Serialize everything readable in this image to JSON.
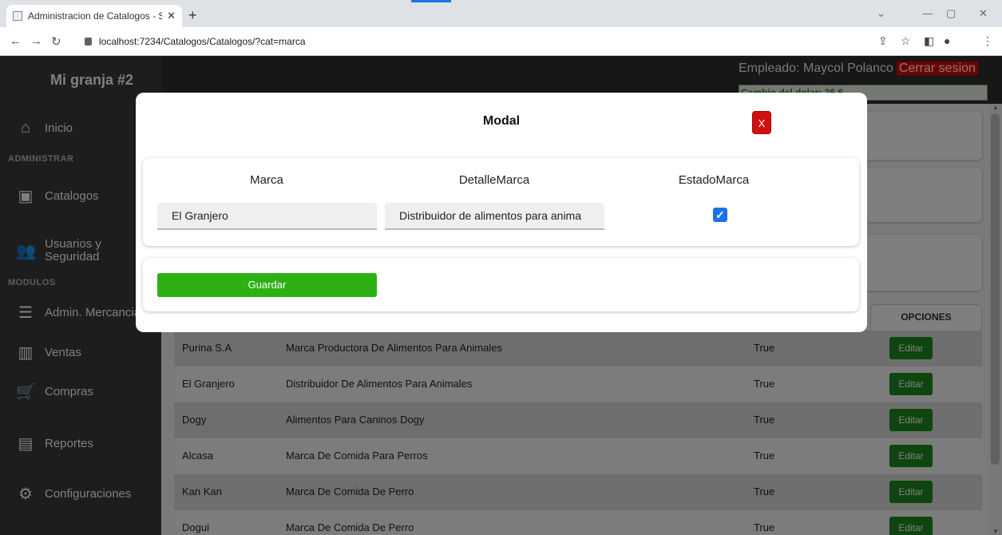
{
  "browser": {
    "tab_title": "Administracion de Catalogos - Si",
    "tab_close": "✕",
    "new_tab": "+",
    "url": "localhost:7234/Catalogos/Catalogos/?cat=marca"
  },
  "app": {
    "brand": "Mi granja #2",
    "empleado_label": "Empleado: Maycol Polanco",
    "logout_label": "Cerrar sesion",
    "dolar_label": "Cambio del dolar: 36.6"
  },
  "sidebar": {
    "inicio": "Inicio",
    "section_admin": "ADMINISTRAR",
    "catalogos": "Catalogos",
    "usuarios_line1": "Usuarios y",
    "usuarios_line2": "Seguridad",
    "section_modulos": "MODULOS",
    "mercancia": "Admin. Mercancia",
    "ventas": "Ventas",
    "compras": "Compras",
    "reportes": "Reportes",
    "configuraciones": "Configuraciones"
  },
  "table": {
    "options_header": "OPCIONES",
    "edit_label": "Editar",
    "rows": [
      {
        "marca": "Purina S.A",
        "detalle": "Marca Productora De Alimentos Para Animales",
        "estado": "True"
      },
      {
        "marca": "El Granjero",
        "detalle": "Distribuidor De Alimentos Para Animales",
        "estado": "True"
      },
      {
        "marca": "Dogy",
        "detalle": "Alimentos Para Caninos Dogy",
        "estado": "True"
      },
      {
        "marca": "Alcasa",
        "detalle": "Marca De Comida Para Perros",
        "estado": "True"
      },
      {
        "marca": "Kan Kan",
        "detalle": "Marca De Comida De Perro",
        "estado": "True"
      },
      {
        "marca": "Dogui",
        "detalle": "Marca De Comida De Perro",
        "estado": "True"
      }
    ]
  },
  "modal": {
    "title": "Modal",
    "close_label": "X",
    "col_marca": "Marca",
    "col_detalle": "DetalleMarca",
    "col_estado": "EstadoMarca",
    "marca_value": "El Granjero",
    "detalle_value": "Distribuidor de alimentos para anima",
    "estado_checked": true,
    "save_label": "Guardar"
  }
}
